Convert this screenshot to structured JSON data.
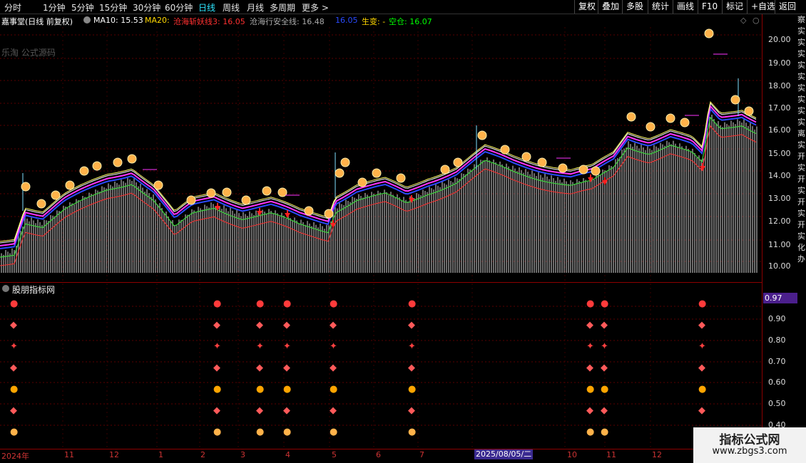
{
  "toolbar": {
    "tabs": [
      "分时",
      "1分钟",
      "5分钟",
      "15分钟",
      "30分钟",
      "60分钟",
      "日线",
      "周线",
      "月线",
      "多周期",
      "更多 >"
    ],
    "active": "日线",
    "right_buttons": [
      "复权",
      "叠加",
      "多股",
      "统计",
      "画线",
      "F10",
      "标记",
      "+自选",
      "返回"
    ]
  },
  "legend": {
    "stock": "嘉事堂(日线 前复权)",
    "ma10": "MA10: 15.53",
    "ma20": "MA20:",
    "line3": "沧海斩妖线3: 16.05",
    "safe": "沧海行安全线: 16.48",
    "v4": "16.05",
    "shengbian": "生变: -",
    "kongcang": "空仓: 16.07",
    "colors": {
      "ma10": "#ffffff",
      "ma20": "#ffd700",
      "line3": "#ff3030",
      "safe": "#aaaaaa",
      "v4": "#2a4bff",
      "sheng": "#ffd700",
      "kong": "#00ff00"
    }
  },
  "faint_watermark": "乐淘 公式源码",
  "price_axis": [
    "20.00",
    "19.00",
    "18.00",
    "17.00",
    "16.00",
    "15.00",
    "14.00",
    "13.00",
    "12.00",
    "11.00",
    "10.00"
  ],
  "sub_indicator": {
    "title": "股朋指标网",
    "current_value": "0.97",
    "axis": [
      "0.90",
      "0.80",
      "0.70",
      "0.60",
      "0.50",
      "0.40"
    ]
  },
  "date_axis": [
    "2024年",
    "11",
    "12",
    "1",
    "2",
    "3",
    "4",
    "5",
    "6",
    "7",
    "2025/08/05/二",
    "10",
    "11",
    "12"
  ],
  "right_strip_text": "察实实实实实实实实实离实开实开实开实开实化办",
  "site_watermark": {
    "line1": "指标公式网",
    "line2": "www.zbgs3.com"
  }
}
